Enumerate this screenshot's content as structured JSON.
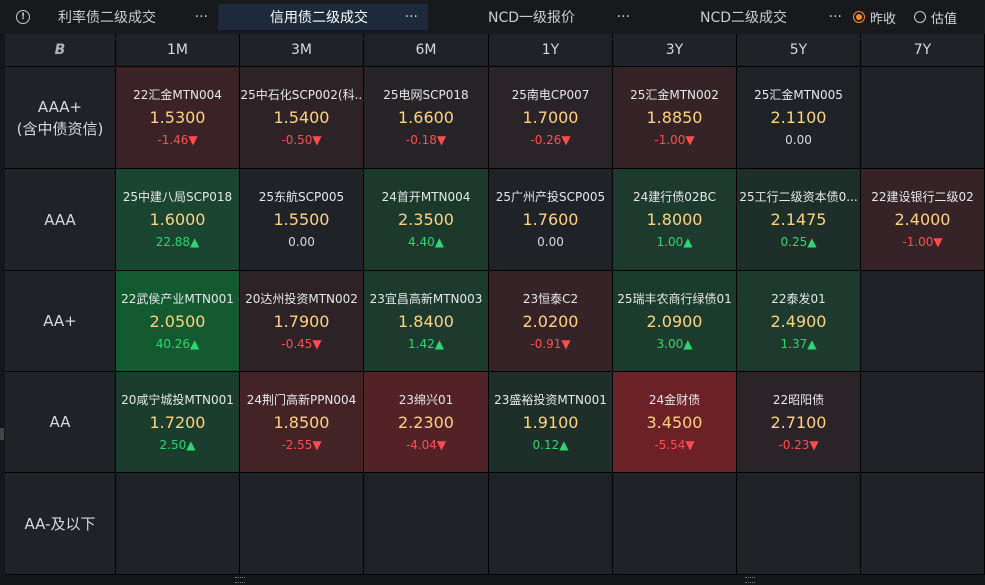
{
  "tabs": [
    {
      "label": "利率债二级成交",
      "active": false
    },
    {
      "label": "信用债二级成交",
      "active": true
    },
    {
      "label": "NCD一级报价",
      "active": false
    },
    {
      "label": "NCD二级成交",
      "active": false
    }
  ],
  "tab_more": "···",
  "info_glyph": "!",
  "radio_options": [
    {
      "label": "昨收",
      "selected": true
    },
    {
      "label": "估值",
      "selected": false
    }
  ],
  "corner_glyph": "B",
  "columns": [
    "1M",
    "3M",
    "6M",
    "1Y",
    "3Y",
    "5Y",
    "7Y"
  ],
  "rows": [
    {
      "label_lines": [
        "AAA+",
        "(含中债资信)"
      ]
    },
    {
      "label_lines": [
        "AAA"
      ]
    },
    {
      "label_lines": [
        "AA+"
      ]
    },
    {
      "label_lines": [
        "AA"
      ]
    },
    {
      "label_lines": [
        "AA-及以下"
      ]
    }
  ],
  "cells": [
    [
      {
        "name": "22汇金MTN004",
        "yield": "1.5300",
        "change": "-1.46▼",
        "dir": "down",
        "bg": "#3b2227"
      },
      {
        "name": "25中石化SCP002(科...",
        "yield": "1.5400",
        "change": "-0.50▼",
        "dir": "down",
        "bg": "#2d2327"
      },
      {
        "name": "25电网SCP018",
        "yield": "1.6600",
        "change": "-0.18▼",
        "dir": "down",
        "bg": "#272428"
      },
      {
        "name": "25南电CP007",
        "yield": "1.7000",
        "change": "-0.26▼",
        "dir": "down",
        "bg": "#2a2428"
      },
      {
        "name": "25汇金MTN002",
        "yield": "1.8850",
        "change": "-1.00▼",
        "dir": "down",
        "bg": "#362327"
      },
      {
        "name": "25汇金MTN005",
        "yield": "2.1100",
        "change": "0.00",
        "dir": "flat",
        "bg": "#1f2226"
      },
      null
    ],
    [
      {
        "name": "25中建八局SCP018",
        "yield": "1.6000",
        "change": "22.88▲",
        "dir": "up",
        "bg": "#1a4530"
      },
      {
        "name": "25东航SCP005",
        "yield": "1.5500",
        "change": "0.00",
        "dir": "flat",
        "bg": "#1f2226"
      },
      {
        "name": "24首开MTN004",
        "yield": "2.3500",
        "change": "4.40▲",
        "dir": "up",
        "bg": "#1b3a2c"
      },
      {
        "name": "25广州产投SCP005",
        "yield": "1.7600",
        "change": "0.00",
        "dir": "flat",
        "bg": "#1f2226"
      },
      {
        "name": "24建行债02BC",
        "yield": "1.8000",
        "change": "1.00▲",
        "dir": "up",
        "bg": "#1c3a2d"
      },
      {
        "name": "25工行二级资本债0...",
        "yield": "2.1475",
        "change": "0.25▲",
        "dir": "up",
        "bg": "#1e2f29"
      },
      {
        "name": "22建设银行二级02",
        "yield": "2.4000",
        "change": "-1.00▼",
        "dir": "down",
        "bg": "#362327"
      }
    ],
    [
      {
        "name": "22武侯产业MTN001",
        "yield": "2.0500",
        "change": "40.26▲",
        "dir": "up",
        "bg": "#145a30"
      },
      {
        "name": "20达州投资MTN002",
        "yield": "1.7900",
        "change": "-0.45▼",
        "dir": "down",
        "bg": "#2d2327"
      },
      {
        "name": "23宜昌高新MTN003",
        "yield": "1.8400",
        "change": "1.42▲",
        "dir": "up",
        "bg": "#1c3a2d"
      },
      {
        "name": "23恒泰C2",
        "yield": "2.0200",
        "change": "-0.91▼",
        "dir": "down",
        "bg": "#352327"
      },
      {
        "name": "25瑞丰农商行绿债01",
        "yield": "2.0900",
        "change": "3.00▲",
        "dir": "up",
        "bg": "#1b3c2d"
      },
      {
        "name": "22泰发01",
        "yield": "2.4900",
        "change": "1.37▲",
        "dir": "up",
        "bg": "#1c3a2d"
      },
      null
    ],
    [
      {
        "name": "20咸宁城投MTN001",
        "yield": "1.7200",
        "change": "2.50▲",
        "dir": "up",
        "bg": "#1b3d2d"
      },
      {
        "name": "24荆门高新PPN004",
        "yield": "1.8500",
        "change": "-2.55▼",
        "dir": "down",
        "bg": "#442326"
      },
      {
        "name": "23绵兴01",
        "yield": "2.2300",
        "change": "-4.04▼",
        "dir": "down",
        "bg": "#532226"
      },
      {
        "name": "23盛裕投资MTN001",
        "yield": "1.9100",
        "change": "0.12▲",
        "dir": "up",
        "bg": "#1e2f29"
      },
      {
        "name": "24金财债",
        "yield": "3.4500",
        "change": "-5.54▼",
        "dir": "down",
        "bg": "#6b2126"
      },
      {
        "name": "22昭阳债",
        "yield": "2.7100",
        "change": "-0.23▼",
        "dir": "down",
        "bg": "#2a2428"
      },
      null
    ],
    [
      null,
      null,
      null,
      null,
      null,
      null,
      null
    ]
  ],
  "colors": {
    "accent": "#ff8c1a",
    "up": "#2ed573",
    "down": "#ff4d4f",
    "yield": "#ffd27f",
    "active_tab": "#1d2a3b"
  }
}
